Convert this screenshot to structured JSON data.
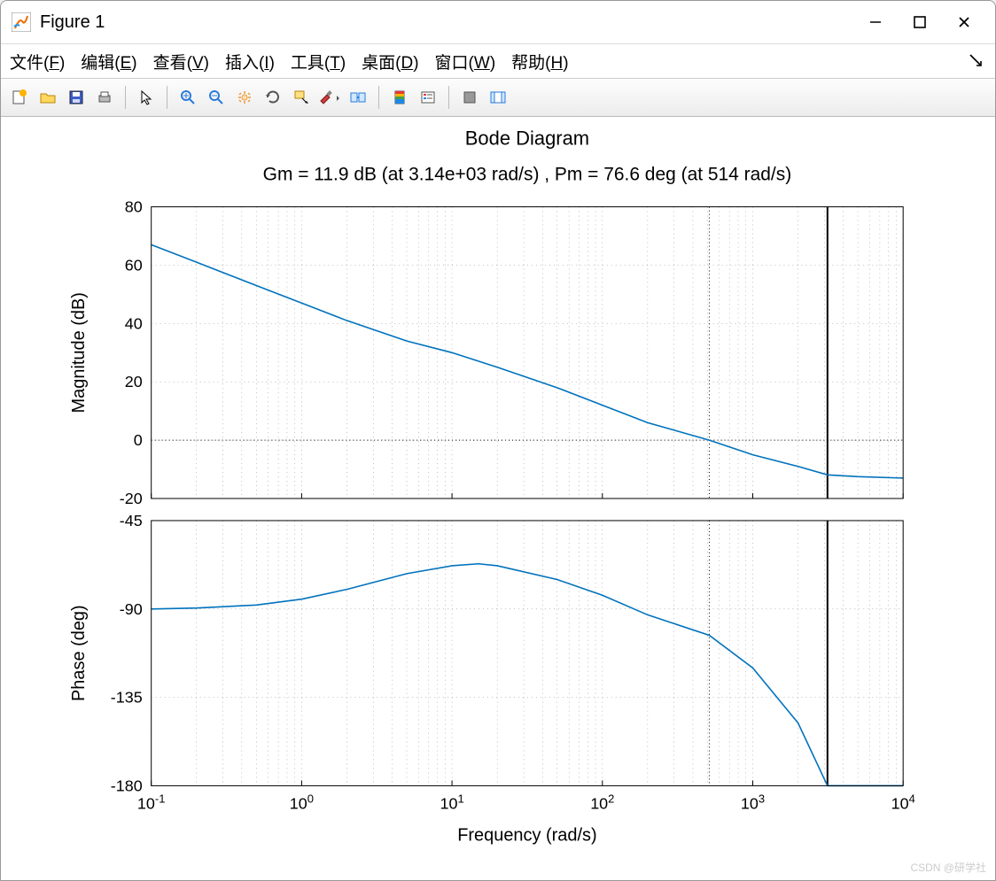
{
  "window": {
    "title": "Figure 1"
  },
  "menu": {
    "file": "文件(F)",
    "edit": "编辑(E)",
    "view": "查看(V)",
    "insert": "插入(I)",
    "tools": "工具(T)",
    "desktop": "桌面(D)",
    "window": "窗口(W)",
    "help": "帮助(H)"
  },
  "toolbar_icons": [
    "new",
    "open",
    "save",
    "print",
    "pointer",
    "zoom-in",
    "zoom-out",
    "pan",
    "rotate",
    "data-cursor",
    "brush",
    "link",
    "colorbar",
    "legend",
    "hide",
    "dock"
  ],
  "chart_data": {
    "type": "line",
    "title": "Bode Diagram",
    "subtitle": "Gm = 11.9 dB (at 3.14e+03 rad/s) ,  Pm = 76.6 deg (at 514 rad/s)",
    "xlabel": "Frequency  (rad/s)",
    "xscale": "log",
    "xlim": [
      0.1,
      10000
    ],
    "xticks": [
      0.1,
      1,
      10,
      100,
      1000,
      10000
    ],
    "xtick_labels": [
      "10^{-1}",
      "10^{0}",
      "10^{1}",
      "10^{2}",
      "10^{3}",
      "10^{4}"
    ],
    "gain_margin_db": 11.9,
    "gain_margin_freq": 3140,
    "phase_margin_deg": 76.6,
    "phase_margin_freq": 514,
    "subplots": [
      {
        "ylabel": "Magnitude (dB)",
        "ylim": [
          -20,
          80
        ],
        "yticks": [
          -20,
          0,
          20,
          40,
          60,
          80
        ],
        "series": [
          {
            "name": "magnitude",
            "color": "#0072bd",
            "x": [
              0.1,
              0.2,
              0.5,
              1,
              2,
              5,
              10,
              20,
              50,
              100,
              200,
              514,
              1000,
              2000,
              3140,
              5000,
              10000
            ],
            "y": [
              67,
              61,
              53,
              47,
              41,
              34,
              30,
              25,
              18,
              12,
              6,
              0,
              -5,
              -9,
              -11.9,
              -12.5,
              -13
            ]
          }
        ],
        "markers": [
          {
            "type": "vline",
            "x": 514,
            "style": "dotted"
          },
          {
            "type": "vline",
            "x": 3140,
            "style": "solid"
          },
          {
            "type": "hline",
            "y": 0,
            "style": "dotted"
          }
        ]
      },
      {
        "ylabel": "Phase (deg)",
        "ylim": [
          -180,
          -45
        ],
        "yticks": [
          -180,
          -135,
          -90,
          -45
        ],
        "series": [
          {
            "name": "phase",
            "color": "#0072bd",
            "x": [
              0.1,
              0.2,
              0.5,
              1,
              2,
              5,
              10,
              15,
              20,
              50,
              100,
              200,
              514,
              1000,
              2000,
              3140,
              5000,
              10000
            ],
            "y": [
              -90,
              -89.5,
              -88,
              -85,
              -80,
              -72,
              -68,
              -67,
              -68,
              -75,
              -83,
              -93,
              -103.4,
              -120,
              -148,
              -180,
              -180,
              -180
            ]
          }
        ],
        "markers": [
          {
            "type": "vline",
            "x": 514,
            "style": "dotted"
          },
          {
            "type": "vline",
            "x": 3140,
            "style": "solid"
          }
        ]
      }
    ]
  },
  "watermark": "CSDN @研学社"
}
